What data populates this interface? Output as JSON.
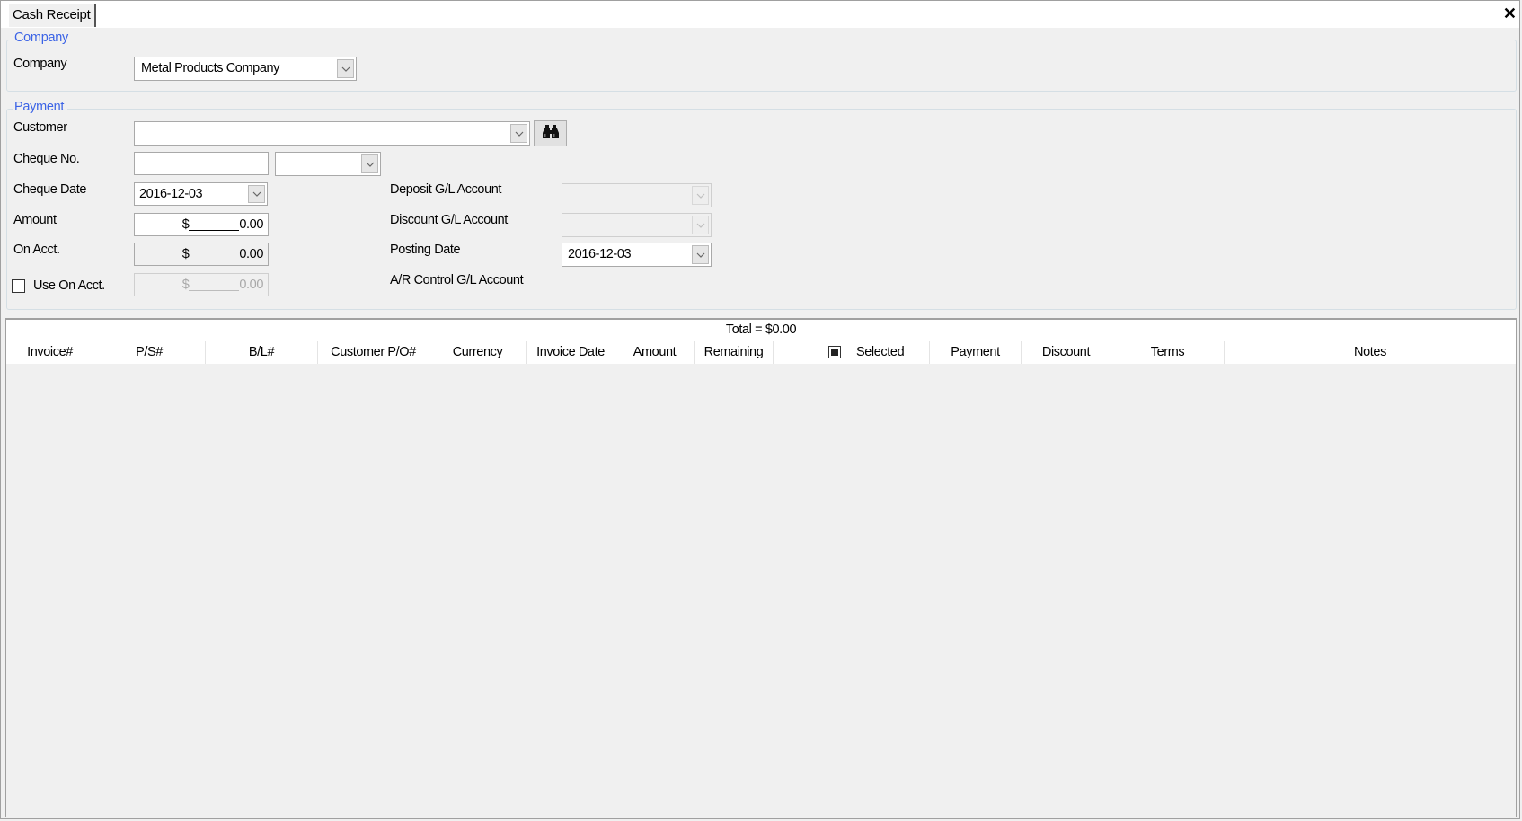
{
  "window": {
    "tab_label": "Cash Receipt",
    "close_icon": "close-icon"
  },
  "company_group": {
    "legend": "Company",
    "company_label": "Company",
    "company_value": "Metal Products Company"
  },
  "payment_group": {
    "legend": "Payment",
    "customer_label": "Customer",
    "customer_value": "",
    "customer_search_icon": "binoculars-icon",
    "cheque_no_label": "Cheque No.",
    "cheque_no_value": "",
    "cheque_type_value": "",
    "cheque_date_label": "Cheque Date",
    "cheque_date_value": "2016-12-03",
    "amount_label": "Amount",
    "amount_currency": "$",
    "amount_value": "0.00",
    "on_acct_label": "On Acct.",
    "on_acct_currency": "$",
    "on_acct_value": "0.00",
    "use_on_acct_label": "Use On Acct.",
    "use_on_acct_checked": false,
    "use_on_acct_currency": "$",
    "use_on_acct_value": "0.00",
    "deposit_gl_label": "Deposit G/L Account",
    "deposit_gl_value": "",
    "discount_gl_label": "Discount G/L Account",
    "discount_gl_value": "",
    "posting_date_label": "Posting Date",
    "posting_date_value": "2016-12-03",
    "ar_control_gl_label": "A/R Control G/L Account",
    "ar_control_gl_value": ""
  },
  "grid": {
    "total_text": "Total = $0.00",
    "columns": [
      {
        "label": "Invoice#"
      },
      {
        "label": "P/S#"
      },
      {
        "label": "B/L#"
      },
      {
        "label": "Customer P/O#"
      },
      {
        "label": "Currency"
      },
      {
        "label": "Invoice Date"
      },
      {
        "label": "Amount"
      },
      {
        "label": "Remaining"
      },
      {
        "label": "Selected"
      },
      {
        "label": "Payment"
      },
      {
        "label": "Discount"
      },
      {
        "label": "Terms"
      },
      {
        "label": "Notes"
      }
    ],
    "select_all_state": "indeterminate",
    "rows": []
  }
}
